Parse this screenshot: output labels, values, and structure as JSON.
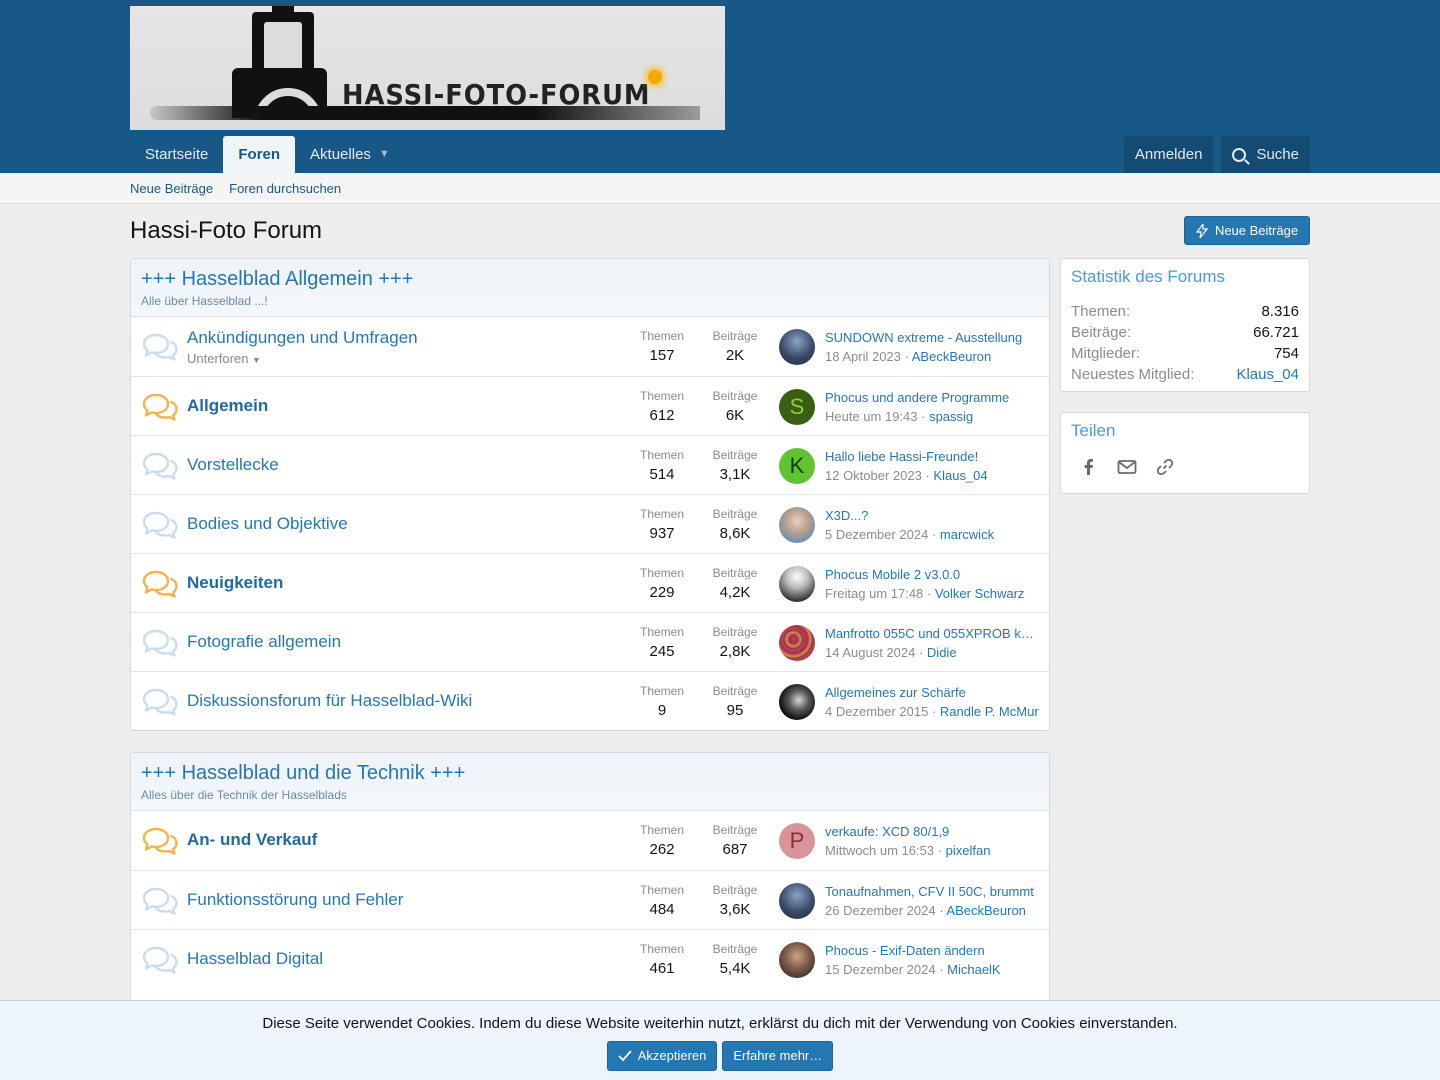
{
  "logo": {
    "text": "HASSI-FOTO-FORUM"
  },
  "nav": {
    "tabs": [
      {
        "label": "Startseite"
      },
      {
        "label": "Foren"
      },
      {
        "label": "Aktuelles"
      }
    ],
    "login_label": "Anmelden",
    "search_label": "Suche"
  },
  "subnav": {
    "items": [
      "Neue Beiträge",
      "Foren durchsuchen"
    ]
  },
  "page": {
    "title": "Hassi-Foto Forum",
    "new_posts_label": "Neue Beiträge"
  },
  "labels": {
    "threads": "Themen",
    "posts": "Beiträge"
  },
  "categories": [
    {
      "title": "+++ Hasselblad Allgemein +++",
      "desc": "Alle über Hasselblad ...!",
      "forums": [
        {
          "name": "Ankündigungen und Umfragen",
          "sub": "Unterforen",
          "threads": "157",
          "posts": "2K",
          "last_title": "SUNDOWN extreme - Ausstellung",
          "last_date": "18 April 2023",
          "last_user": "ABeckBeuron",
          "unread": false
        },
        {
          "name": "Allgemein",
          "threads": "612",
          "posts": "6K",
          "last_title": "Phocus und andere Programme",
          "last_date": "Heute um 19:43",
          "last_user": "spassig",
          "avatar_letter": "S",
          "unread": true
        },
        {
          "name": "Vorstellecke",
          "threads": "514",
          "posts": "3,1K",
          "last_title": "Hallo liebe Hassi-Freunde!",
          "last_date": "12 Oktober 2023",
          "last_user": "Klaus_04",
          "avatar_letter": "K",
          "unread": false
        },
        {
          "name": "Bodies und Objektive",
          "threads": "937",
          "posts": "8,6K",
          "last_title": "X3D...?",
          "last_date": "5 Dezember 2024",
          "last_user": "marcwick",
          "unread": false
        },
        {
          "name": "Neuigkeiten",
          "threads": "229",
          "posts": "4,2K",
          "last_title": "Phocus Mobile 2 v3.0.0",
          "last_date": "Freitag um 17:48",
          "last_user": "Volker Schwarz",
          "unread": true
        },
        {
          "name": "Fotografie allgemein",
          "threads": "245",
          "posts": "2,8K",
          "last_title": "Manfrotto 055C und 055XPROB k…",
          "last_date": "14 August 2024",
          "last_user": "Didie",
          "unread": false
        },
        {
          "name": "Diskussionsforum für Hasselblad-Wiki",
          "threads": "9",
          "posts": "95",
          "last_title": "Allgemeines zur Schärfe",
          "last_date": "4 Dezember 2015",
          "last_user": "Randle P. McMurphy",
          "unread": false
        }
      ]
    },
    {
      "title": "+++ Hasselblad und die Technik +++",
      "desc": "Alles über die Technik der Hasselblads",
      "forums": [
        {
          "name": "An- und Verkauf",
          "threads": "262",
          "posts": "687",
          "last_title": "verkaufe: XCD 80/1,9",
          "last_date": "Mittwoch um 16:53",
          "last_user": "pixelfan",
          "avatar_letter": "P",
          "unread": true
        },
        {
          "name": "Funktionsstörung und Fehler",
          "threads": "484",
          "posts": "3,6K",
          "last_title": "Tonaufnahmen, CFV II 50C, brummt",
          "last_date": "26 Dezember 2024",
          "last_user": "ABeckBeuron",
          "unread": false
        },
        {
          "name": "Hasselblad Digital",
          "threads": "461",
          "posts": "5,4K",
          "last_title": "Phocus - Exif-Daten ändern",
          "last_date": "15 Dezember 2024",
          "last_user": "MichaelK",
          "unread": false
        }
      ]
    }
  ],
  "stats": {
    "title": "Statistik des Forums",
    "rows": [
      {
        "label": "Themen:",
        "value": "8.316"
      },
      {
        "label": "Beiträge:",
        "value": "66.721"
      },
      {
        "label": "Mitglieder:",
        "value": "754"
      },
      {
        "label": "Neuestes Mitglied:",
        "value": "Klaus_04"
      }
    ]
  },
  "share": {
    "title": "Teilen",
    "icons": [
      "facebook-icon",
      "email-icon",
      "link-icon"
    ]
  },
  "cookie": {
    "message": "Diese Seite verwendet Cookies. Indem du diese Website weiterhin nutzt, erklärst du dich mit der Verwendung von Cookies einverstanden.",
    "accept_label": "Akzeptieren",
    "more_label": "Erfahre mehr…"
  },
  "colors": {
    "header": "#185886",
    "accent": "#2577b1",
    "unread_icon": "#f6b34a",
    "read_icon": "#c9dcec"
  }
}
